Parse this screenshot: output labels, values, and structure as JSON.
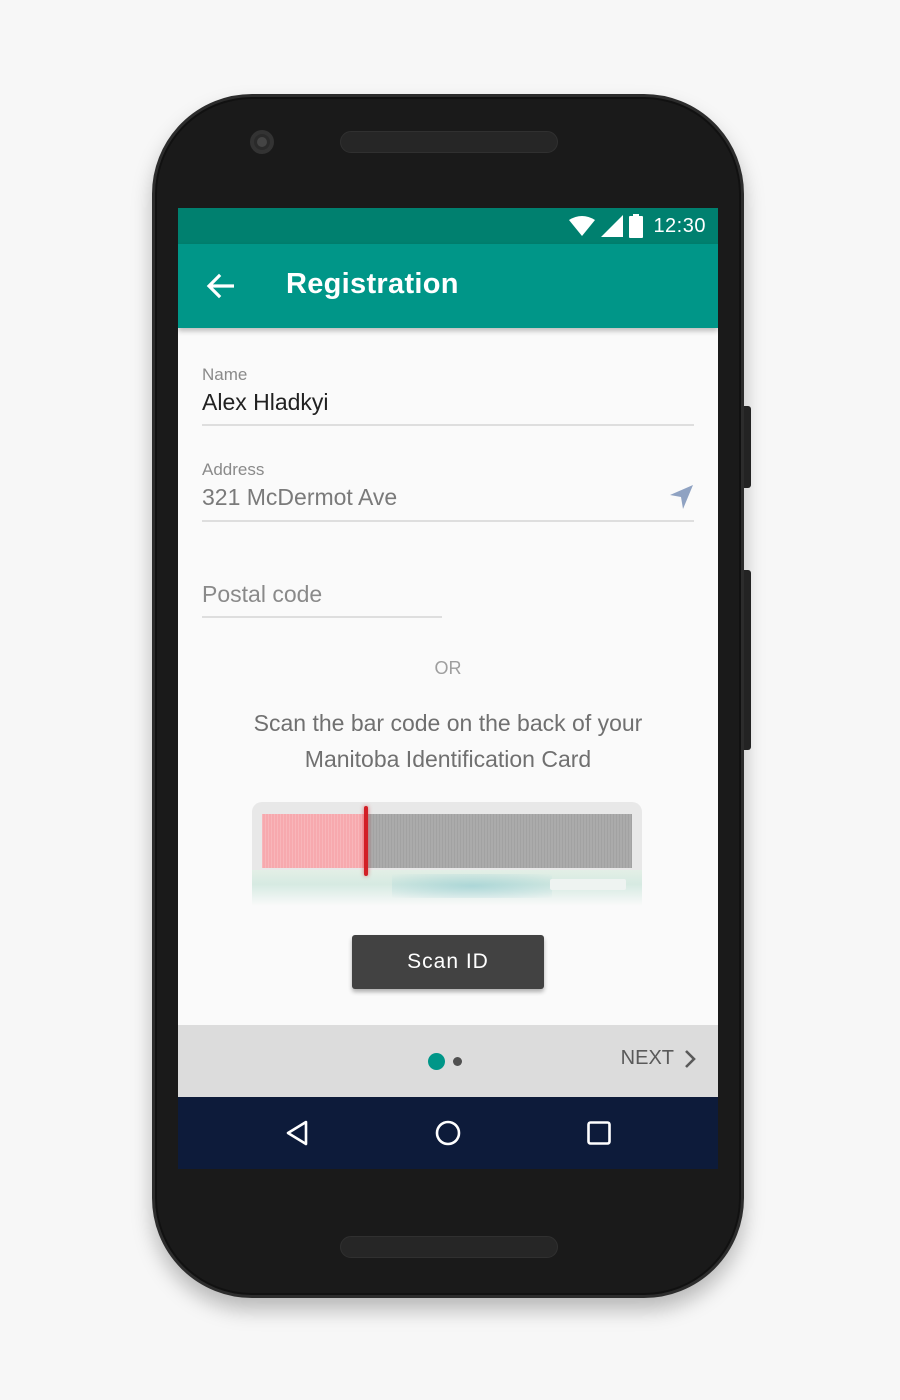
{
  "status_bar": {
    "time": "12:30",
    "icons": [
      "wifi-icon",
      "signal-icon",
      "battery-icon"
    ]
  },
  "app_bar": {
    "title": "Registration",
    "back_icon": "arrow-back-icon",
    "color": "#009688"
  },
  "form": {
    "name": {
      "label": "Name",
      "value": "Alex Hladkyi"
    },
    "address": {
      "label": "Address",
      "value": "321 McDermot Ave",
      "icon": "location-arrow-icon"
    },
    "postal_code": {
      "placeholder": "Postal code"
    }
  },
  "separator": "OR",
  "instruction": {
    "line1": "Scan the bar code on the back of your",
    "line2": "Manitoba Identification Card"
  },
  "scan_progress": 0.28,
  "scan_button": {
    "label": "Scan ID"
  },
  "pager": {
    "active_page": 1,
    "total_pages": 2,
    "next_label": "NEXT",
    "next_icon": "chevron-right-icon"
  },
  "nav_bar": {
    "icons": [
      "back-triangle-icon",
      "home-circle-icon",
      "recents-square-icon"
    ]
  },
  "colors": {
    "accent": "#009688",
    "status_bar": "#00806f",
    "nav_bar": "#0d1b3a",
    "scan_line": "#d21f26"
  }
}
